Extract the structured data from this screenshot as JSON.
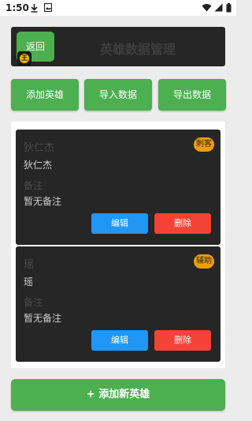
{
  "status_bar": {
    "time": "1:50",
    "icons": [
      "download-icon",
      "image-icon",
      "wifi-icon",
      "signal-icon",
      "battery-icon"
    ]
  },
  "header": {
    "back_label": "返回",
    "title": "英雄数据管理",
    "app_icon_glyph": "王"
  },
  "actions": {
    "add_hero": "添加英雄",
    "import_data": "导入数据",
    "export_data": "导出数据"
  },
  "heroes": [
    {
      "name_label": "狄仁杰",
      "name": "狄仁杰",
      "role": "刺客",
      "note_label": "备注",
      "note": "暂无备注",
      "edit_label": "编辑",
      "delete_label": "删除"
    },
    {
      "name_label": "瑶",
      "name": "瑶",
      "role": "辅助",
      "note_label": "备注",
      "note": "暂无备注",
      "edit_label": "编辑",
      "delete_label": "删除"
    }
  ],
  "add_new_button": "+ 添加新英雄",
  "colors": {
    "primary_green": "#4caf50",
    "edit_blue": "#2196f3",
    "delete_red": "#f44336",
    "badge_orange": "#f29d00",
    "card_dark": "#262626"
  }
}
